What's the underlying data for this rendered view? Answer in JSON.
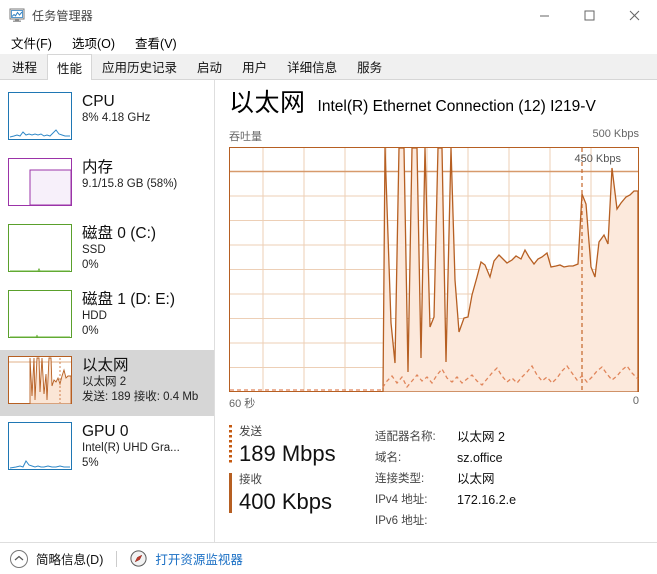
{
  "window": {
    "title": "任务管理器",
    "icon": "task-manager-icon",
    "minimize_label": "—",
    "maximize_label": "□",
    "close_label": "✕"
  },
  "menu": {
    "items": [
      {
        "label": "文件(F)"
      },
      {
        "label": "选项(O)"
      },
      {
        "label": "查看(V)"
      }
    ]
  },
  "tabs": {
    "active_index": 1,
    "items": [
      {
        "label": "进程"
      },
      {
        "label": "性能"
      },
      {
        "label": "应用历史记录"
      },
      {
        "label": "启动"
      },
      {
        "label": "用户"
      },
      {
        "label": "详细信息"
      },
      {
        "label": "服务"
      }
    ]
  },
  "sidebar": {
    "items": [
      {
        "name": "cpu",
        "title": "CPU",
        "line2": "8% 4.18 GHz",
        "line3": "",
        "color": "#1f77b4",
        "selected": false
      },
      {
        "name": "memory",
        "title": "内存",
        "line2": "9.1/15.8 GB (58%)",
        "line3": "",
        "color": "#9b33a8",
        "selected": false
      },
      {
        "name": "disk-0",
        "title": "磁盘 0 (C:)",
        "line2": "SSD",
        "line3": "0%",
        "color": "#5aa02c",
        "selected": false
      },
      {
        "name": "disk-1",
        "title": "磁盘 1 (D: E:)",
        "line2": "HDD",
        "line3": "0%",
        "color": "#5aa02c",
        "selected": false
      },
      {
        "name": "ethernet",
        "title": "以太网",
        "line2": "以太网 2",
        "line3": "发送: 189 接收: 0.4 Mb",
        "color": "#b65f22",
        "selected": true
      },
      {
        "name": "gpu-0",
        "title": "GPU 0",
        "line2": "Intel(R) UHD Gra...",
        "line3": "5%",
        "color": "#1f77b4",
        "selected": false
      }
    ]
  },
  "main": {
    "title": "以太网",
    "subtitle": "Intel(R) Ethernet Connection (12) I219-V",
    "graph_label": "吞吐量",
    "y_max_label": "500 Kbps",
    "peak_label": "450 Kbps",
    "x_left_label": "60 秒",
    "x_right_label": "0"
  },
  "stats": {
    "send_label": "发送",
    "send_value": "189 Mbps",
    "receive_label": "接收",
    "receive_value": "400 Kbps"
  },
  "details": {
    "keys": [
      "适配器名称:",
      "域名:",
      "连接类型:",
      "IPv4 地址:",
      "IPv6 地址:"
    ],
    "values": [
      "以太网 2",
      "sz.office",
      "以太网",
      "172.16.2.e",
      ""
    ]
  },
  "statusbar": {
    "collapse_label": "简略信息(D)",
    "resource_monitor_label": "打开资源监视器"
  },
  "colors": {
    "accent_orange": "#b65f22",
    "fill_orange": "#fce9dc",
    "grid_orange": "#edcfb6",
    "link_blue": "#1a6fc4",
    "selected_gray": "#d6d6d6"
  },
  "chart_data": {
    "type": "area",
    "title": "吞吐量",
    "ylabel": "",
    "xlabel": "",
    "ylim": [
      0,
      500
    ],
    "y_unit": "Kbps",
    "x_range_seconds": 60,
    "grid": true,
    "reference_line": {
      "value": 450,
      "label": "450 Kbps"
    },
    "marker_line_x_pct": 86,
    "series": [
      {
        "name": "发送",
        "style": "solid",
        "color": "#b65f22",
        "values": [
          0,
          0,
          0,
          0,
          0,
          0,
          0,
          0,
          0,
          0,
          0,
          0,
          0,
          0,
          0,
          0,
          0,
          0,
          0,
          0,
          0,
          0,
          0,
          0,
          0,
          0,
          0,
          0,
          0,
          0,
          0,
          0,
          0,
          0,
          0,
          0,
          0,
          0,
          500,
          140,
          60,
          500,
          500,
          40,
          500,
          500,
          60,
          500,
          350,
          120,
          500,
          500,
          500,
          100,
          500,
          60,
          110,
          500,
          500,
          70,
          190,
          175,
          150,
          245,
          230,
          215,
          205,
          210,
          260,
          460,
          330,
          345,
          350
        ]
      },
      {
        "name": "接收",
        "style": "dashed",
        "color": "#e0855a",
        "values": [
          0,
          0,
          0,
          0,
          0,
          0,
          0,
          0,
          0,
          0,
          0,
          0,
          0,
          0,
          0,
          0,
          0,
          0,
          0,
          0,
          0,
          0,
          0,
          0,
          0,
          0,
          0,
          0,
          0,
          0,
          0,
          0,
          0,
          0,
          0,
          0,
          0,
          0,
          12,
          28,
          16,
          12,
          22,
          14,
          18,
          30,
          20,
          16,
          45,
          18,
          14,
          12,
          18,
          24,
          40,
          18,
          14,
          22,
          16,
          28,
          44,
          26,
          18,
          14,
          20,
          34,
          18,
          14,
          22,
          30,
          18,
          14,
          26
        ]
      }
    ]
  }
}
